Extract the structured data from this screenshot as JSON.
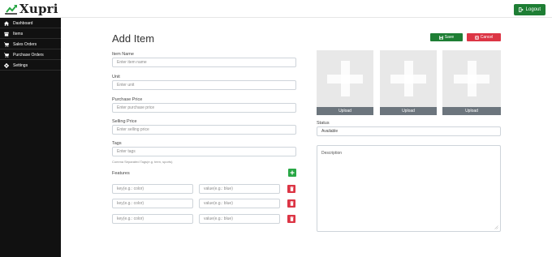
{
  "app": {
    "brand": "Xupri",
    "logout_label": "Logout"
  },
  "sidebar": {
    "items": [
      {
        "label": "Dashboard",
        "icon": "home-icon"
      },
      {
        "label": "Items",
        "icon": "items-icon"
      },
      {
        "label": "Sales Orders",
        "icon": "cart-icon"
      },
      {
        "label": "Purchase Orders",
        "icon": "cart-icon"
      },
      {
        "label": "Settings",
        "icon": "gear-icon"
      }
    ]
  },
  "page": {
    "title": "Add Item",
    "save_label": "Save",
    "cancel_label": "Cancel"
  },
  "form": {
    "item_name": {
      "label": "Item Name",
      "placeholder": "Enter item name"
    },
    "unit": {
      "label": "Unit",
      "placeholder": "Enter unit"
    },
    "purchase_price": {
      "label": "Purchase Price",
      "placeholder": "Enter purchase price"
    },
    "selling_price": {
      "label": "Selling Price",
      "placeholder": "Enter selling price"
    },
    "tags": {
      "label": "Tags",
      "placeholder": "Enter tags",
      "hint": "Comma Separated Tags(e.g. teen, sports)"
    },
    "features": {
      "label": "Features",
      "rows": [
        {
          "key_placeholder": "key(e.g.: color)",
          "value_placeholder": "value(e.g.: blue)"
        },
        {
          "key_placeholder": "key(e.g.: color)",
          "value_placeholder": "value(e.g.: blue)"
        },
        {
          "key_placeholder": "key(e.g.: color)",
          "value_placeholder": "value(e.g.: blue)"
        }
      ]
    },
    "images": {
      "upload_label": "Upload"
    },
    "status": {
      "label": "Status",
      "value": "Available"
    },
    "description": {
      "placeholder": "Description"
    }
  },
  "colors": {
    "primary_green": "#1e7e34",
    "danger_red": "#dc3545",
    "sidebar_bg": "#111111",
    "upload_gray": "#6c757d"
  }
}
